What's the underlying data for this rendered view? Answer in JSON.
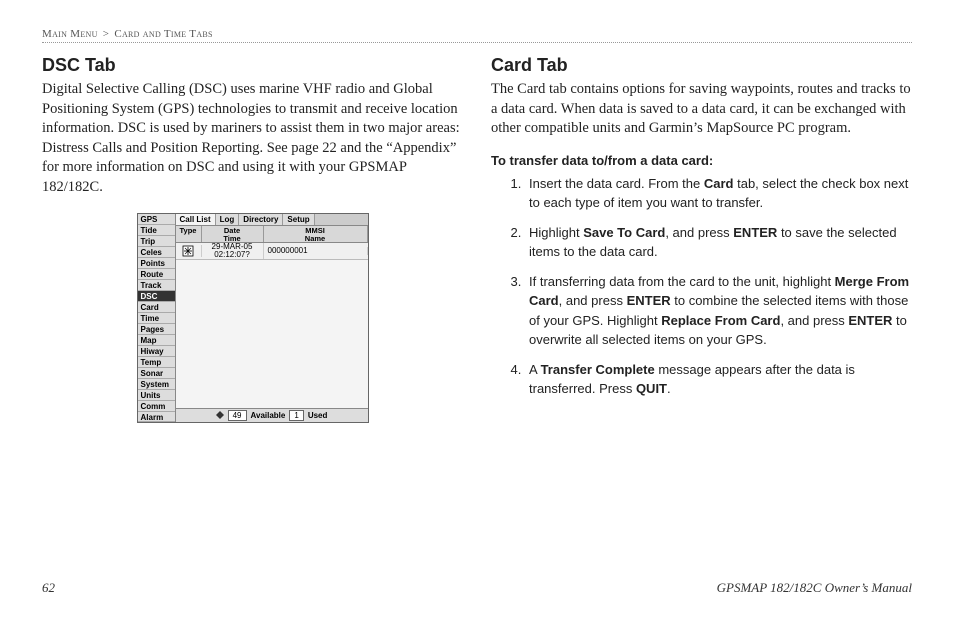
{
  "breadcrumb": {
    "part1": "Main Menu",
    "sep": ">",
    "part2": "Card and Time Tabs"
  },
  "left": {
    "heading": "DSC Tab",
    "body": "Digital Selective Calling (DSC) uses marine VHF radio and Global Positioning System (GPS) technologies to transmit and receive location information. DSC is used by mariners to assist them in two major areas: Distress Calls and Position Reporting. See page 22 and the “Appendix” for more information on DSC and using it with your GPSMAP 182/182C."
  },
  "right": {
    "heading": "Card Tab",
    "body": "The Card tab contains options for saving waypoints, routes and tracks to a data card. When data is saved to a data card, it can be exchanged with other compatible units and Garmin’s MapSource PC program.",
    "subhead": "To transfer data to/from a data card:",
    "steps": {
      "s1a": "Insert the data card. From the ",
      "s1b": "Card",
      "s1c": " tab, select the check box next to each type of item you want to transfer.",
      "s2a": "Highlight ",
      "s2b": "Save To Card",
      "s2c": ", and press ",
      "s2d": "ENTER",
      "s2e": " to save the selected items to the data card.",
      "s3a": "If transferring data from the card to the unit, highlight ",
      "s3b": "Merge From Card",
      "s3c": ", and press ",
      "s3d": "ENTER",
      "s3e": " to combine the selected items with those of your GPS. Highlight ",
      "s3f": "Replace From Card",
      "s3g": ", and press ",
      "s3h": "ENTER",
      "s3i": " to overwrite all selected items on your GPS.",
      "s4a": "A ",
      "s4b": "Transfer Complete",
      "s4c": " message appears after the data is transferred. Press ",
      "s4d": "QUIT",
      "s4e": "."
    }
  },
  "gps": {
    "tabs": [
      "GPS",
      "Tide",
      "Trip",
      "Celes",
      "Points",
      "Route",
      "Track",
      "DSC",
      "Card",
      "Time",
      "Pages",
      "Map",
      "Hiway",
      "Temp",
      "Sonar",
      "System",
      "Units",
      "Comm",
      "Alarm"
    ],
    "subtabs": [
      "Call List",
      "Log",
      "Directory",
      "Setup"
    ],
    "activeTab": "DSC",
    "activeSubtab": "Call List",
    "header": {
      "type": "Type",
      "date": "Date\nTime",
      "mmsi": "MMSI\nName"
    },
    "row": {
      "date": "29-MAR-05\n02:12:07?",
      "mmsi": "000000001"
    },
    "footer": {
      "available_count": "49",
      "available_label": "Available",
      "used_count": "1",
      "used_label": "Used"
    }
  },
  "footer": {
    "page": "62",
    "title": "GPSMAP 182/182C Owner’s Manual"
  }
}
